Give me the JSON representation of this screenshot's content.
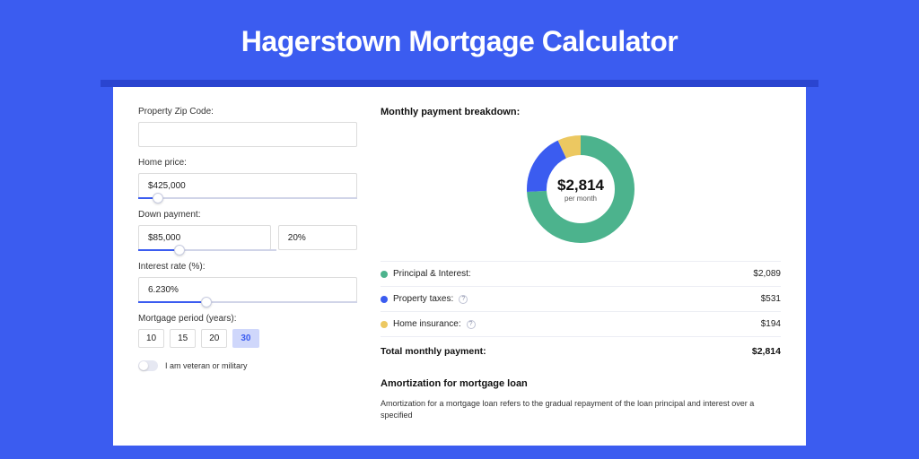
{
  "title": "Hagerstown Mortgage Calculator",
  "form": {
    "zip_label": "Property Zip Code:",
    "zip_value": "",
    "home_price_label": "Home price:",
    "home_price_value": "$425,000",
    "down_payment_label": "Down payment:",
    "down_payment_value": "$85,000",
    "down_payment_pct": "20%",
    "interest_label": "Interest rate (%):",
    "interest_value": "6.230%",
    "period_label": "Mortgage period (years):",
    "period_options": [
      "10",
      "15",
      "20",
      "30"
    ],
    "period_selected": "30",
    "veteran_label": "I am veteran or military"
  },
  "breakdown": {
    "header": "Monthly payment breakdown:",
    "total_amount": "$2,814",
    "total_sub": "per month",
    "items": [
      {
        "label": "Principal & Interest:",
        "amount": "$2,089",
        "color": "#4cb38d"
      },
      {
        "label": "Property taxes:",
        "amount": "$531",
        "color": "#3b5cf0",
        "info": true
      },
      {
        "label": "Home insurance:",
        "amount": "$194",
        "color": "#ecc861",
        "info": true
      }
    ],
    "total_label": "Total monthly payment:",
    "total_value": "$2,814"
  },
  "amort": {
    "header": "Amortization for mortgage loan",
    "text": "Amortization for a mortgage loan refers to the gradual repayment of the loan principal and interest over a specified"
  },
  "chart_data": {
    "type": "pie",
    "title": "Monthly payment breakdown",
    "series": [
      {
        "name": "Principal & Interest",
        "value": 2089,
        "color": "#4cb38d"
      },
      {
        "name": "Property taxes",
        "value": 531,
        "color": "#3b5cf0"
      },
      {
        "name": "Home insurance",
        "value": 194,
        "color": "#ecc861"
      }
    ],
    "total": 2814,
    "center_label": "$2,814",
    "center_sub": "per month"
  }
}
